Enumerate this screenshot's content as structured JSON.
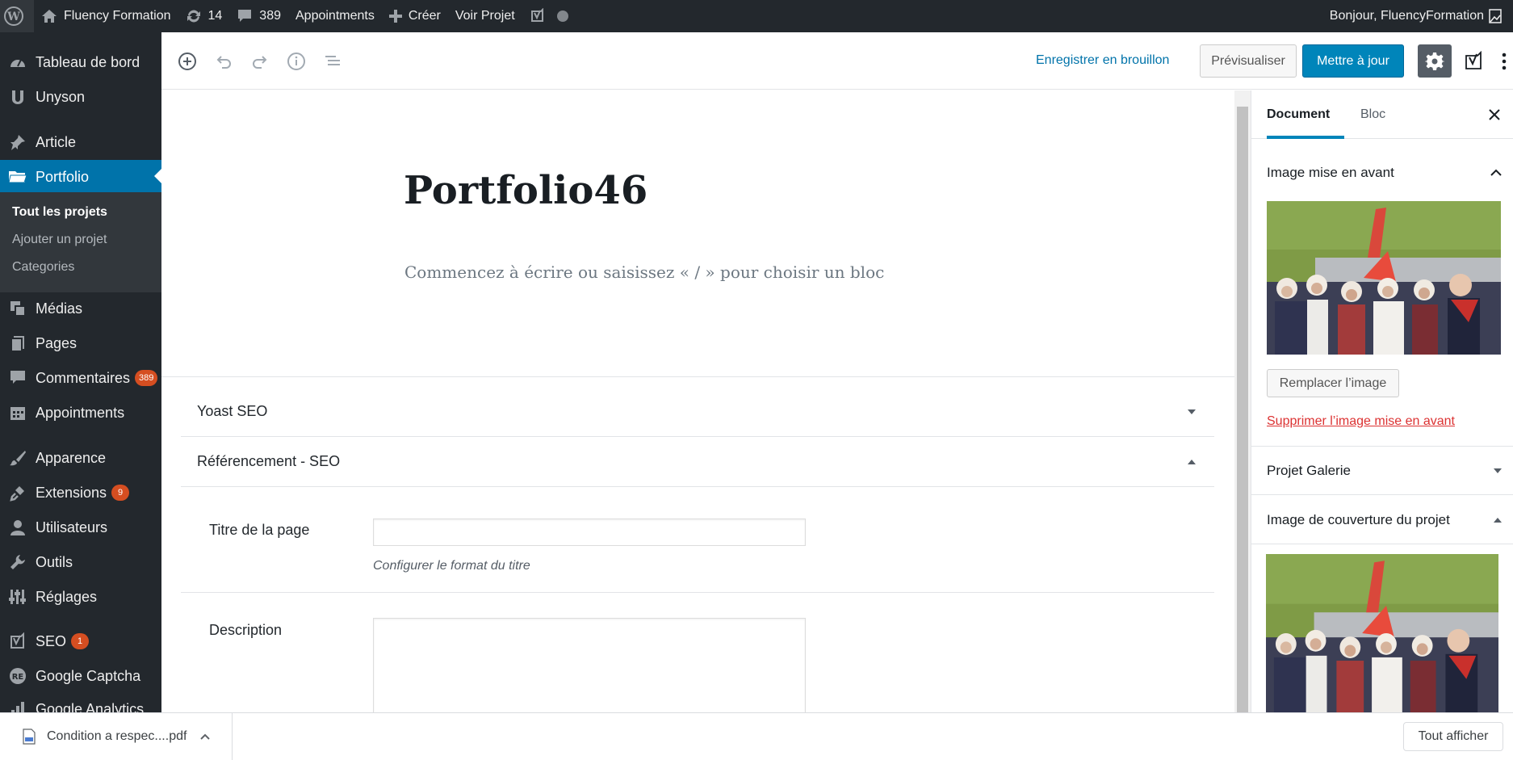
{
  "admin_bar": {
    "site_name": "Fluency Formation",
    "updates_count": "14",
    "comments_count": "389",
    "appointments": "Appointments",
    "new_label": "Créer",
    "view_label": "Voir Projet",
    "greeting": "Bonjour, FluencyFormation"
  },
  "sidebar": {
    "items": [
      {
        "label": "Tableau de bord",
        "icon": "dashboard-icon"
      },
      {
        "label": "Unyson",
        "icon": "unyson-icon"
      },
      {
        "label": "Article",
        "icon": "pin-icon"
      },
      {
        "label": "Portfolio",
        "icon": "folder-icon"
      },
      {
        "label": "Médias",
        "icon": "media-icon"
      },
      {
        "label": "Pages",
        "icon": "pages-icon"
      },
      {
        "label": "Commentaires",
        "icon": "comment-icon",
        "badge": "389"
      },
      {
        "label": "Appointments",
        "icon": "calendar-icon"
      },
      {
        "label": "Apparence",
        "icon": "brush-icon"
      },
      {
        "label": "Extensions",
        "icon": "plugin-icon",
        "badge": "9"
      },
      {
        "label": "Utilisateurs",
        "icon": "user-icon"
      },
      {
        "label": "Outils",
        "icon": "wrench-icon"
      },
      {
        "label": "Réglages",
        "icon": "settings-icon"
      },
      {
        "label": "SEO",
        "icon": "yoast-icon",
        "badge": "1"
      },
      {
        "label": "Google Captcha",
        "icon": "recaptcha-icon"
      },
      {
        "label": "Google Analytics",
        "icon": "analytics-icon"
      }
    ],
    "submenu": [
      "Tout les projets",
      "Ajouter un projet",
      "Categories"
    ]
  },
  "toolbar": {
    "save_draft": "Enregistrer en brouillon",
    "preview": "Prévisualiser",
    "update": "Mettre à jour"
  },
  "editor": {
    "title": "Portfolio46",
    "placeholder": "Commencez à écrire ou saisissez « / » pour choisir un bloc"
  },
  "metaboxes": {
    "yoast": "Yoast SEO",
    "seo": "Référencement - SEO",
    "page_title_label": "Titre de la page",
    "page_title_value": "",
    "page_title_hint": "Configurer le format du titre",
    "description_label": "Description",
    "description_value": ""
  },
  "settings": {
    "tabs": [
      "Document",
      "Bloc"
    ],
    "featured_image": "Image mise en avant",
    "replace_image": "Remplacer l’image",
    "remove_image": "Supprimer l’image mise en avant",
    "gallery": "Projet Galerie",
    "cover_image": "Image de couverture du projet"
  },
  "downloads": {
    "file_name": "Condition a respec....pdf",
    "show_all": "Tout afficher"
  },
  "colors": {
    "admin_dark": "#23282d",
    "accent_blue": "#0073aa",
    "badge_orange": "#d54e21",
    "danger_red": "#dc3232"
  }
}
